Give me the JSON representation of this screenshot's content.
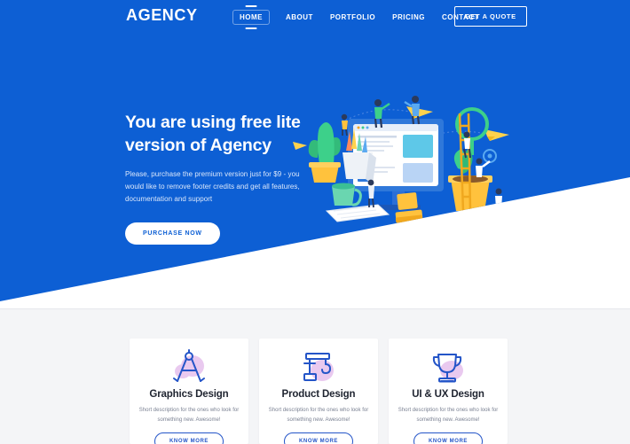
{
  "brand": {
    "logo": "AGENCY"
  },
  "nav": {
    "items": [
      {
        "label": "HOME",
        "active": true
      },
      {
        "label": "ABOUT",
        "active": false
      },
      {
        "label": "PORTFOLIO",
        "active": false
      },
      {
        "label": "PRICING",
        "active": false
      },
      {
        "label": "CONTACT",
        "active": false
      }
    ],
    "cta_label": "GET A QUOTE"
  },
  "hero": {
    "title_line1": "You are using free lite",
    "title_line2": "version of Agency",
    "subtitle": "Please, purchase the premium version just for $9 - you would like to remove footer credits and get all features, documentation and support",
    "button_label": "PURCHASE NOW",
    "illustration_name": "workspace-desktop-illustration"
  },
  "services": {
    "cards": [
      {
        "icon": "compass-divider-icon",
        "title": "Graphics Design",
        "description": "Short description for the ones who look for something new. Awesome!",
        "button_label": "KNOW MORE"
      },
      {
        "icon": "crane-hook-icon",
        "title": "Product Design",
        "description": "Short description for the ones who look for something new. Awesome!",
        "button_label": "KNOW MORE"
      },
      {
        "icon": "trophy-icon",
        "title": "UI & UX Design",
        "description": "Short description for the ones who look for something new. Awesome!",
        "button_label": "KNOW MORE"
      }
    ]
  },
  "colors": {
    "brand_blue": "#0d5fd4",
    "accent_blue": "#2455c8",
    "icon_blob_pink": "#e9c9ef",
    "section_bg": "#f4f5f7",
    "card_bg": "#ffffff",
    "text_dark": "#1f2430",
    "text_muted": "#7b8293",
    "hero_sub": "#dce8fb",
    "illus_yellow": "#f5a623",
    "illus_green": "#3cc98a"
  }
}
